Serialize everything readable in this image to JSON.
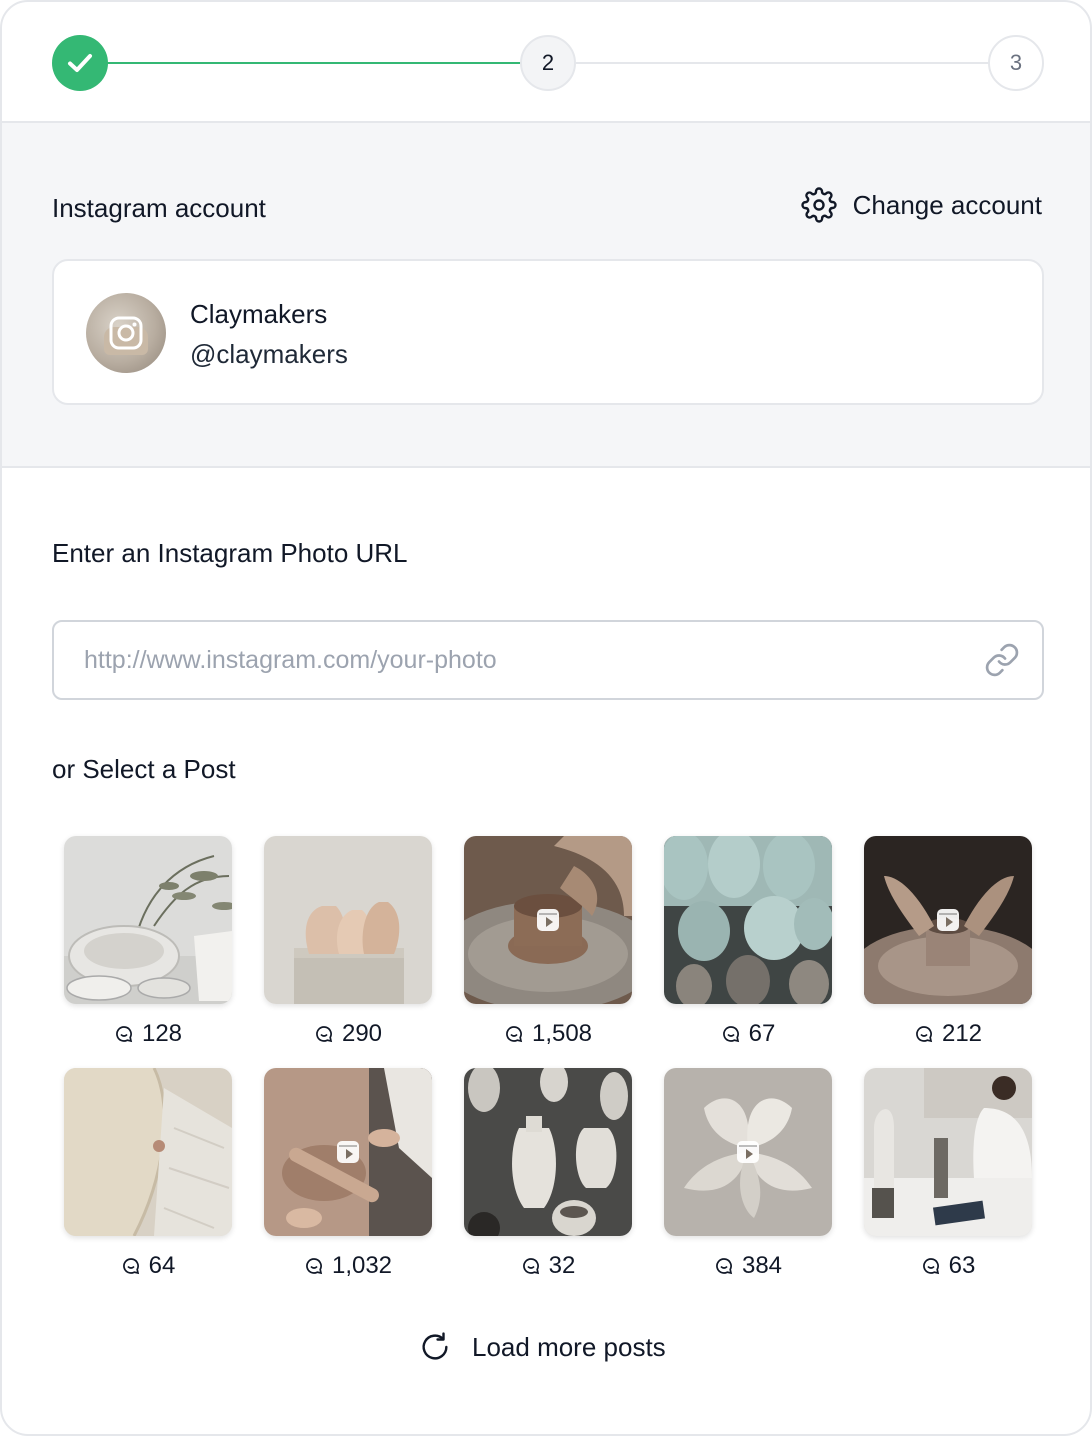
{
  "stepper": {
    "steps": [
      {
        "label": "",
        "state": "complete"
      },
      {
        "label": "2",
        "state": "current"
      },
      {
        "label": "3",
        "state": "upcoming"
      }
    ],
    "colors": {
      "complete": "#34b874",
      "inactive_line": "#e5e7eb"
    }
  },
  "account": {
    "section_title": "Instagram account",
    "change_label": "Change account",
    "name": "Claymakers",
    "handle": "@claymakers"
  },
  "url": {
    "title": "Enter an Instagram Photo URL",
    "placeholder": "http://www.instagram.com/your-photo",
    "value": ""
  },
  "posts": {
    "title": "or Select a Post",
    "items": [
      {
        "comments": "128",
        "reel": false,
        "subject": "ceramic bowls and eucalyptus"
      },
      {
        "comments": "290",
        "reel": false,
        "subject": "clay vases on pedestal"
      },
      {
        "comments": "1,508",
        "reel": true,
        "subject": "pottery wheel throwing"
      },
      {
        "comments": "67",
        "reel": false,
        "subject": "teal glazed bottles"
      },
      {
        "comments": "212",
        "reel": true,
        "subject": "hands shaping clay"
      },
      {
        "comments": "64",
        "reel": false,
        "subject": "cream plate on linen"
      },
      {
        "comments": "1,032",
        "reel": true,
        "subject": "rolling clay slab"
      },
      {
        "comments": "32",
        "reel": false,
        "subject": "speckled ceramic bottles"
      },
      {
        "comments": "384",
        "reel": true,
        "subject": "clay flower sculpture"
      },
      {
        "comments": "63",
        "reel": false,
        "subject": "artist in studio"
      }
    ]
  },
  "load_more_label": "Load more posts"
}
